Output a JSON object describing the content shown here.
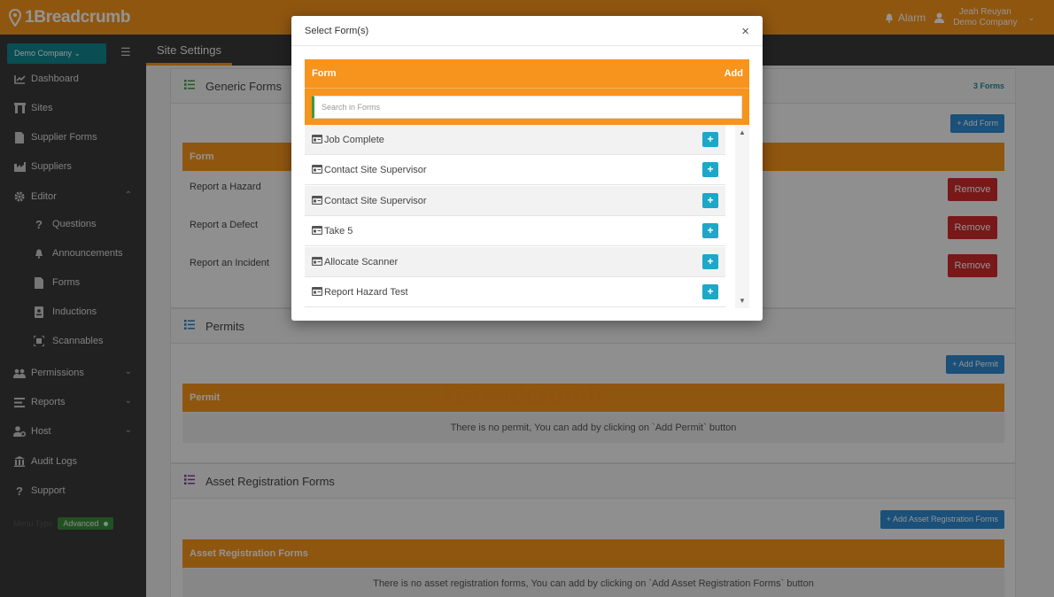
{
  "topbar": {
    "logo_text": "1Breadcrumb",
    "alarm_label": "Alarm",
    "user_name": "Jeah Reuyan",
    "user_company": "Demo Company"
  },
  "sidebar": {
    "company_label": "Demo Company ⌄",
    "items": [
      {
        "label": "Dashboard",
        "icon": "chart-line-icon"
      },
      {
        "label": "Sites",
        "icon": "building-icon"
      },
      {
        "label": "Supplier Forms",
        "icon": "file-icon"
      },
      {
        "label": "Suppliers",
        "icon": "industry-icon"
      },
      {
        "label": "Editor",
        "icon": "gear-icon"
      },
      {
        "label": "Questions",
        "icon": "question-icon"
      },
      {
        "label": "Announcements",
        "icon": "bell-icon"
      },
      {
        "label": "Forms",
        "icon": "file-icon"
      },
      {
        "label": "Inductions",
        "icon": "id-card-icon"
      },
      {
        "label": "Scannables",
        "icon": "scan-icon"
      },
      {
        "label": "Permissions",
        "icon": "users-icon"
      },
      {
        "label": "Reports",
        "icon": "list-icon"
      },
      {
        "label": "Host",
        "icon": "user-gear-icon"
      },
      {
        "label": "Audit Logs",
        "icon": "bank-icon"
      },
      {
        "label": "Support",
        "icon": "question-icon"
      }
    ],
    "menu_type_label": "Menu Type",
    "menu_type_value": "Advanced"
  },
  "subheader": {
    "title": "Site Settings"
  },
  "generic_forms": {
    "title": "Generic Forms",
    "count": "3 Forms",
    "add_button": "Add Form",
    "column_header": "Form",
    "rows": [
      {
        "name": "Report a Hazard",
        "action": "Remove"
      },
      {
        "name": "Report a Defect",
        "action": "Remove"
      },
      {
        "name": "Report an Incident",
        "action": "Remove"
      }
    ]
  },
  "permits": {
    "title": "Permits",
    "add_button": "Add Permit",
    "column_header": "Permit",
    "empty_text": "There is no permit, You can add by clicking on `Add Permit` button"
  },
  "asset_forms": {
    "title": "Asset Registration Forms",
    "add_button": "Add Asset Registration Forms",
    "column_header": "Asset Registration Forms",
    "empty_text": "There is no asset registration forms, You can add by clicking on `Add Asset Registration Forms` button"
  },
  "watermark": "1Breadcrumb",
  "modal": {
    "title": "Select Form(s)",
    "close_symbol": "×",
    "header_label": "Form",
    "header_add": "Add",
    "search_placeholder": "Search in Forms",
    "add_symbol": "+",
    "items": [
      "Job Complete",
      "Contact Site Supervisor",
      "Contact Site Supervisor",
      "Take 5",
      "Allocate Scanner",
      "Report Hazard Test"
    ]
  },
  "colors": {
    "accent": "#f7941d",
    "teal": "#0f8790",
    "sidebar_bg": "#3a3a3a",
    "danger": "#cf2a2a",
    "info": "#1ea7c7",
    "primary": "#2e8ad0"
  }
}
